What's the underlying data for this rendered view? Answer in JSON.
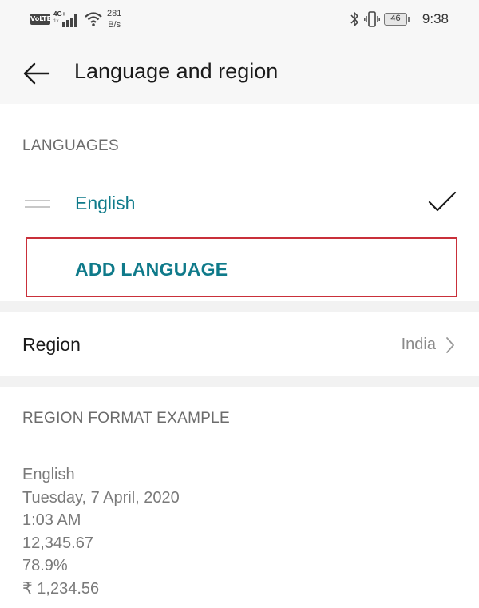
{
  "status_bar": {
    "volte": "VoLTE",
    "network": "4G+",
    "network_sub": "1x",
    "speed_value": "281",
    "speed_unit": "B/s",
    "battery": "46",
    "time": "9:38"
  },
  "header": {
    "title": "Language and region",
    "back_icon": "arrow-left-icon"
  },
  "languages": {
    "section_label": "LANGUAGES",
    "items": [
      {
        "name": "English",
        "selected": true
      }
    ],
    "add_label": "ADD LANGUAGE"
  },
  "region": {
    "label": "Region",
    "value": "India"
  },
  "format_example": {
    "section_label": "REGION FORMAT EXAMPLE",
    "lines": [
      "English",
      "Tuesday, 7 April, 2020",
      "1:03 AM",
      "12,345.67",
      "78.9%",
      "₹ 1,234.56"
    ]
  },
  "colors": {
    "accent": "#0f7a8a",
    "highlight_border": "#c9303a",
    "header_bg": "#f7f7f7"
  }
}
